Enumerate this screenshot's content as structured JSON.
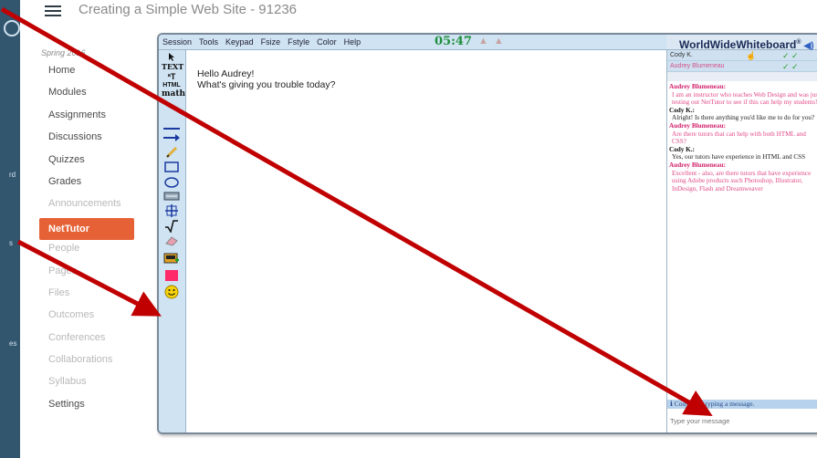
{
  "header": {
    "course_title": "Creating a Simple Web Site - 91236"
  },
  "global_nav": {
    "labels": [
      "rd",
      "s",
      "es"
    ]
  },
  "course_nav": {
    "term": "Spring 2016",
    "items": [
      {
        "label": "Home",
        "state": "normal"
      },
      {
        "label": "Modules",
        "state": "normal"
      },
      {
        "label": "Assignments",
        "state": "normal"
      },
      {
        "label": "Discussions",
        "state": "normal"
      },
      {
        "label": "Quizzes",
        "state": "normal"
      },
      {
        "label": "Grades",
        "state": "normal"
      },
      {
        "label": "Announcements",
        "state": "dim"
      },
      {
        "label": "NetTutor",
        "state": "active"
      },
      {
        "label": "People",
        "state": "dim"
      },
      {
        "label": "Pages",
        "state": "dim"
      },
      {
        "label": "Files",
        "state": "dim"
      },
      {
        "label": "Outcomes",
        "state": "dim"
      },
      {
        "label": "Conferences",
        "state": "dim"
      },
      {
        "label": "Collaborations",
        "state": "dim"
      },
      {
        "label": "Syllabus",
        "state": "dim"
      },
      {
        "label": "Settings",
        "state": "normal"
      }
    ]
  },
  "whiteboard": {
    "menu": [
      "Session",
      "Tools",
      "Keypad",
      "Fsize",
      "Fstyle",
      "Color",
      "Help"
    ],
    "timer": "05:47",
    "brand": "WorldWideWhiteboard",
    "brand_mark": "®",
    "tools": {
      "text_label": "TEXT",
      "html_label": "HTML",
      "math_label": "math"
    },
    "canvas_lines": [
      "Hello Audrey!",
      "What's giving you trouble today?"
    ],
    "participants": [
      {
        "name": "Cody K.",
        "checks": "✓ ✓"
      },
      {
        "name": "Audrey Blumeneau",
        "checks": "✓ ✓"
      }
    ],
    "chat": [
      {
        "speaker": "Audrey Blumeneau:",
        "who": "audrey",
        "text": "I am an instructor who teaches Web Design and was just testing out NetTutor to see if this can help my students!"
      },
      {
        "speaker": "Cody K.:",
        "who": "cody",
        "text": "Alright! Is there anything you'd like me to do for you?"
      },
      {
        "speaker": "Audrey Blumeneau:",
        "who": "audrey",
        "text": "Are there tutors that can help with both HTML and CSS?"
      },
      {
        "speaker": "Cody K.:",
        "who": "cody",
        "text": "Yes, our tutors have experience in HTML and CSS"
      },
      {
        "speaker": "Audrey Blumeneau:",
        "who": "audrey",
        "text": "Excellent - also, are there tutors that have experience using Adobe products such Photoshop, Illustrator, InDesign, Flash and Dreamweaver"
      }
    ],
    "typing_status": "Cody K. is typing a message.",
    "chat_placeholder": "Type your message"
  },
  "colors": {
    "active_nav": "#e66135",
    "annotation_arrow": "#c00000",
    "timer": "#1f8f3a"
  }
}
